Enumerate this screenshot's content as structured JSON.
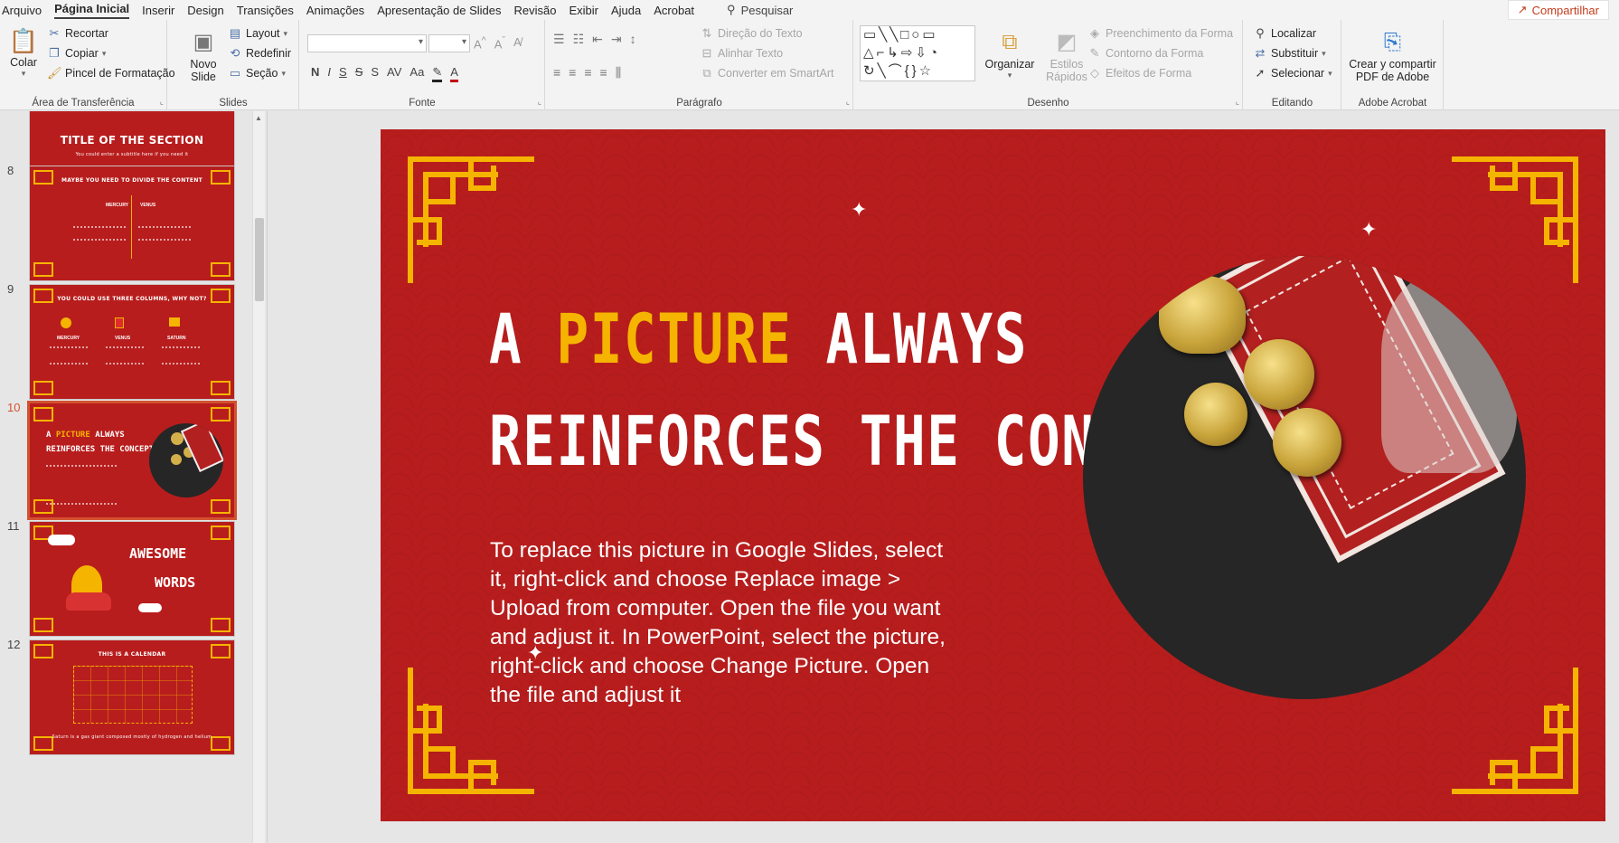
{
  "menubar": {
    "tabs": [
      "Arquivo",
      "Página Inicial",
      "Inserir",
      "Design",
      "Transições",
      "Animações",
      "Apresentação de Slides",
      "Revisão",
      "Exibir",
      "Ajuda",
      "Acrobat"
    ],
    "active_tab": "Página Inicial",
    "search_label": "Pesquisar",
    "share_label": "Compartilhar"
  },
  "ribbon": {
    "clipboard": {
      "label": "Área de Transferência",
      "paste": "Colar",
      "cut": "Recortar",
      "copy": "Copiar",
      "format_painter": "Pincel de Formatação"
    },
    "slides": {
      "label": "Slides",
      "new_slide_1": "Novo",
      "new_slide_2": "Slide",
      "layout": "Layout",
      "reset": "Redefinir",
      "section": "Seção"
    },
    "font": {
      "label": "Fonte",
      "font_name": "",
      "font_size": "",
      "bold": "N",
      "italic": "I",
      "underline": "S",
      "strike": "S",
      "spacing": "AV",
      "case": "Aa"
    },
    "paragraph": {
      "label": "Parágrafo",
      "text_direction": "Direção do Texto",
      "align_text": "Alinhar Texto",
      "smartart": "Converter em SmartArt"
    },
    "drawing": {
      "label": "Desenho",
      "arrange": "Organizar",
      "quick_styles_1": "Estilos",
      "quick_styles_2": "Rápidos",
      "shape_fill": "Preenchimento da Forma",
      "shape_outline": "Contorno da Forma",
      "shape_effects": "Efeitos de Forma"
    },
    "editing": {
      "label": "Editando",
      "find": "Localizar",
      "replace": "Substituir",
      "select": "Selecionar"
    },
    "acrobat": {
      "label": "Adobe Acrobat",
      "create_1": "Crear y compartir",
      "create_2": "PDF de Adobe"
    }
  },
  "thumbnails": [
    {
      "num": "",
      "title": "TITLE OF THE SECTION"
    },
    {
      "num": "8",
      "title": "MAYBE YOU NEED TO DIVIDE THE CONTENT"
    },
    {
      "num": "9",
      "title": "YOU COULD USE THREE COLUMNS, WHY NOT?"
    },
    {
      "num": "10",
      "title": "A PICTURE ALWAYS REINFORCES THE CONCEPT"
    },
    {
      "num": "11",
      "title": "AWESOME WORDS"
    },
    {
      "num": "12",
      "title": "THIS IS A CALENDAR"
    }
  ],
  "thumb_words": {
    "t7_sub": "You could enter a subtitle here if you need it",
    "t8_col1": "MERCURY",
    "t8_col2": "VENUS",
    "t9_col1": "MERCURY",
    "t9_col2": "VENUS",
    "t9_col3": "SATURN",
    "t10_line1a": "A ",
    "t10_line1b": "PICTURE",
    "t10_line1c": " ALWAYS",
    "t10_line2": "REINFORCES THE CONCEPT",
    "t11_line1": "AWESOME",
    "t11_line2": "WORDS",
    "t12_foot": "Saturn is a gas giant composed mostly of hydrogen and helium"
  },
  "slide": {
    "title_line1_a": "A ",
    "title_line1_b": "PICTURE",
    "title_line1_c": " ALWAYS",
    "title_line2": "REINFORCES THE CONCEPT",
    "body": "To replace this picture in Google Slides, select it, right-click and choose Replace image > Upload from computer. Open the file you want and adjust it. In PowerPoint, select the picture, right-click and choose Change Picture. Open the file and adjust it"
  },
  "colors": {
    "slide_bg": "#b81d1d",
    "accent": "#f5b400",
    "share_text": "#c43e1c",
    "selection": "#d35230"
  }
}
